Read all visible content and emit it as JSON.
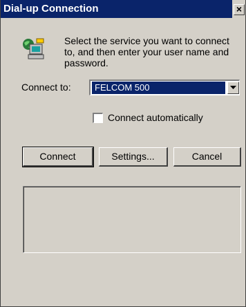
{
  "window": {
    "title": "Dial-up Connection",
    "close_glyph": "×"
  },
  "header": {
    "icon": "network-computer-icon",
    "description": "Select the service you want to connect to, and then enter your user name and password."
  },
  "form": {
    "connect_to_label": "Connect to:",
    "connect_to_value": "FELCOM 500",
    "auto_connect_label": "Connect automatically",
    "auto_connect_checked": false
  },
  "buttons": {
    "connect": "Connect",
    "settings": "Settings...",
    "cancel": "Cancel"
  },
  "status": {
    "text": ""
  },
  "colors": {
    "titlebar": "#0a246a",
    "face": "#d4d0c8",
    "selection": "#0a246a"
  }
}
